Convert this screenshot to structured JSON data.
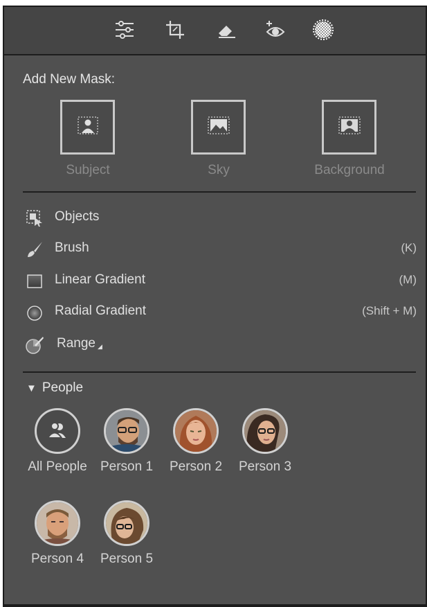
{
  "toolbar": {
    "icons": [
      "sliders-icon",
      "crop-icon",
      "eraser-icon",
      "redeye-icon",
      "masking-icon"
    ]
  },
  "add_mask": {
    "label": "Add New Mask:",
    "options": [
      {
        "label": "Subject",
        "icon": "subject-icon"
      },
      {
        "label": "Sky",
        "icon": "sky-icon"
      },
      {
        "label": "Background",
        "icon": "background-icon"
      }
    ]
  },
  "tools": [
    {
      "label": "Objects",
      "shortcut": "",
      "icon": "objects-icon"
    },
    {
      "label": "Brush",
      "shortcut": "(K)",
      "icon": "brush-icon"
    },
    {
      "label": "Linear Gradient",
      "shortcut": "(M)",
      "icon": "linear-gradient-icon"
    },
    {
      "label": "Radial Gradient",
      "shortcut": "(Shift + M)",
      "icon": "radial-gradient-icon"
    },
    {
      "label": "Range",
      "shortcut": "",
      "icon": "range-icon"
    }
  ],
  "people": {
    "title": "People",
    "items": [
      {
        "label": "All People"
      },
      {
        "label": "Person 1"
      },
      {
        "label": "Person 2"
      },
      {
        "label": "Person 3"
      },
      {
        "label": "Person 4"
      },
      {
        "label": "Person 5"
      }
    ]
  }
}
